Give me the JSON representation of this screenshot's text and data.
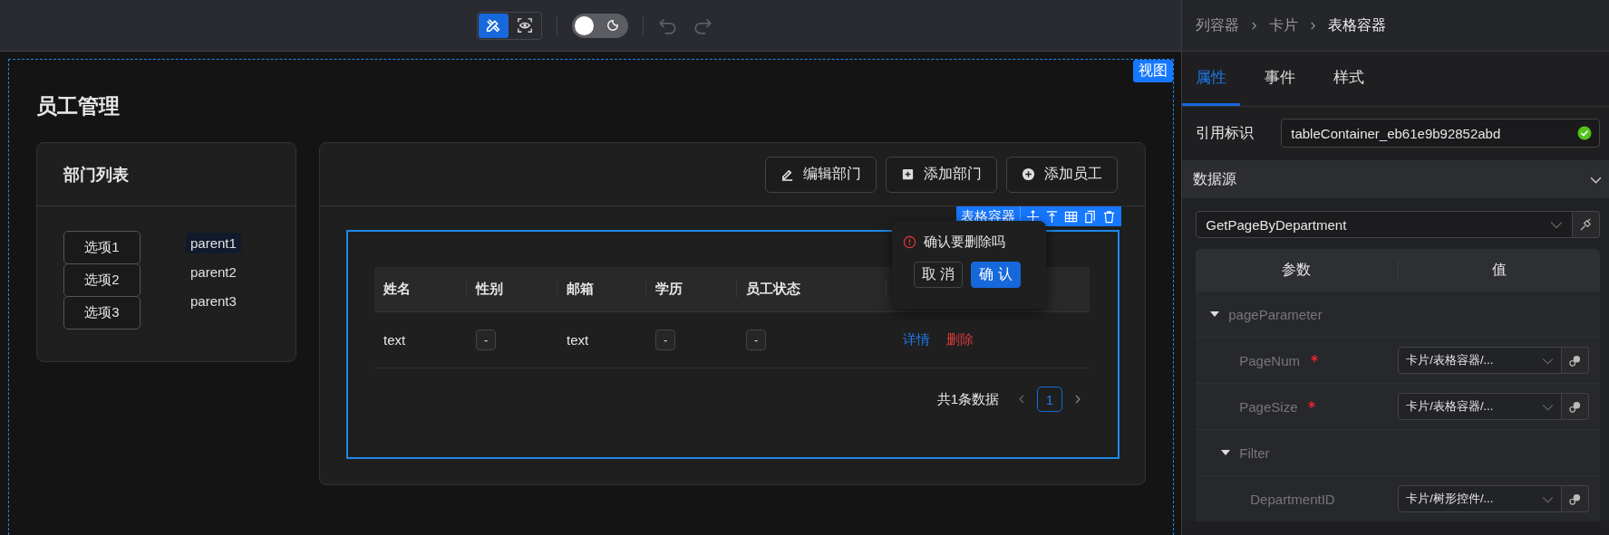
{
  "toolbar": {
    "modes": [
      {
        "kind": "design",
        "selected": true
      },
      {
        "kind": "preview",
        "selected": false
      }
    ],
    "theme_toggle": {
      "on": false
    },
    "undo": {
      "disabled": true
    },
    "redo": {
      "disabled": true
    }
  },
  "canvas": {
    "badge": "视图",
    "title": "员工管理",
    "dept_card": {
      "title": "部门列表",
      "options": [
        {
          "label": "选项1",
          "selected": false
        },
        {
          "label": "选项2",
          "selected": false
        },
        {
          "label": "选项3",
          "selected": false
        }
      ],
      "tree": [
        {
          "label": "parent1",
          "selected": true
        },
        {
          "label": "parent2",
          "selected": false
        },
        {
          "label": "parent3",
          "selected": false
        }
      ]
    },
    "main_card": {
      "buttons": [
        {
          "label": "编辑部门",
          "kind": "edit"
        },
        {
          "label": "添加部门",
          "kind": "add-square"
        },
        {
          "label": "添加员工",
          "kind": "add-circle"
        }
      ],
      "table_container": {
        "badge": "表格容器",
        "columns": [
          "姓名",
          "性别",
          "邮箱",
          "学历",
          "员工状态"
        ],
        "rows": [
          {
            "cells": [
              {
                "kind": "text",
                "text": "text"
              },
              {
                "kind": "tag",
                "text": "-"
              },
              {
                "kind": "text",
                "text": "text"
              },
              {
                "kind": "tag",
                "text": "-"
              },
              {
                "kind": "tag",
                "text": "-"
              }
            ],
            "actions": [
              {
                "label": "详情",
                "kind": "link"
              },
              {
                "label": "删除",
                "kind": "danger"
              }
            ]
          }
        ],
        "total": "共1条数据",
        "pages": [
          {
            "label": "1",
            "selected": true
          }
        ],
        "popconfirm": {
          "message": "确认要删除吗",
          "cancel": "取 消",
          "confirm": "确 认"
        }
      }
    }
  },
  "right_panel": {
    "breadcrumb": [
      "列容器",
      "卡片",
      "表格容器"
    ],
    "tabs": [
      {
        "label": "属性",
        "selected": true
      },
      {
        "label": "事件",
        "selected": false
      },
      {
        "label": "样式",
        "selected": false
      }
    ],
    "ref_field": {
      "label": "引用标识",
      "value": "tableContainer_eb61e9b92852abd",
      "valid": true
    },
    "datasource": {
      "title": "数据源",
      "expanded": true,
      "select": "GetPageByDepartment",
      "header": [
        "参数",
        "值"
      ],
      "params": [
        {
          "name": "pageParameter",
          "expanded": true,
          "children": [
            {
              "name": "PageNum",
              "required": true,
              "value": "卡片/表格容器/..."
            },
            {
              "name": "PageSize",
              "required": true,
              "value": "卡片/表格容器/..."
            },
            {
              "name": "Filter",
              "expanded": true,
              "children": [
                {
                  "name": "DepartmentID",
                  "required": false,
                  "value": "卡片/树形控件/..."
                }
              ]
            }
          ]
        }
      ]
    }
  }
}
